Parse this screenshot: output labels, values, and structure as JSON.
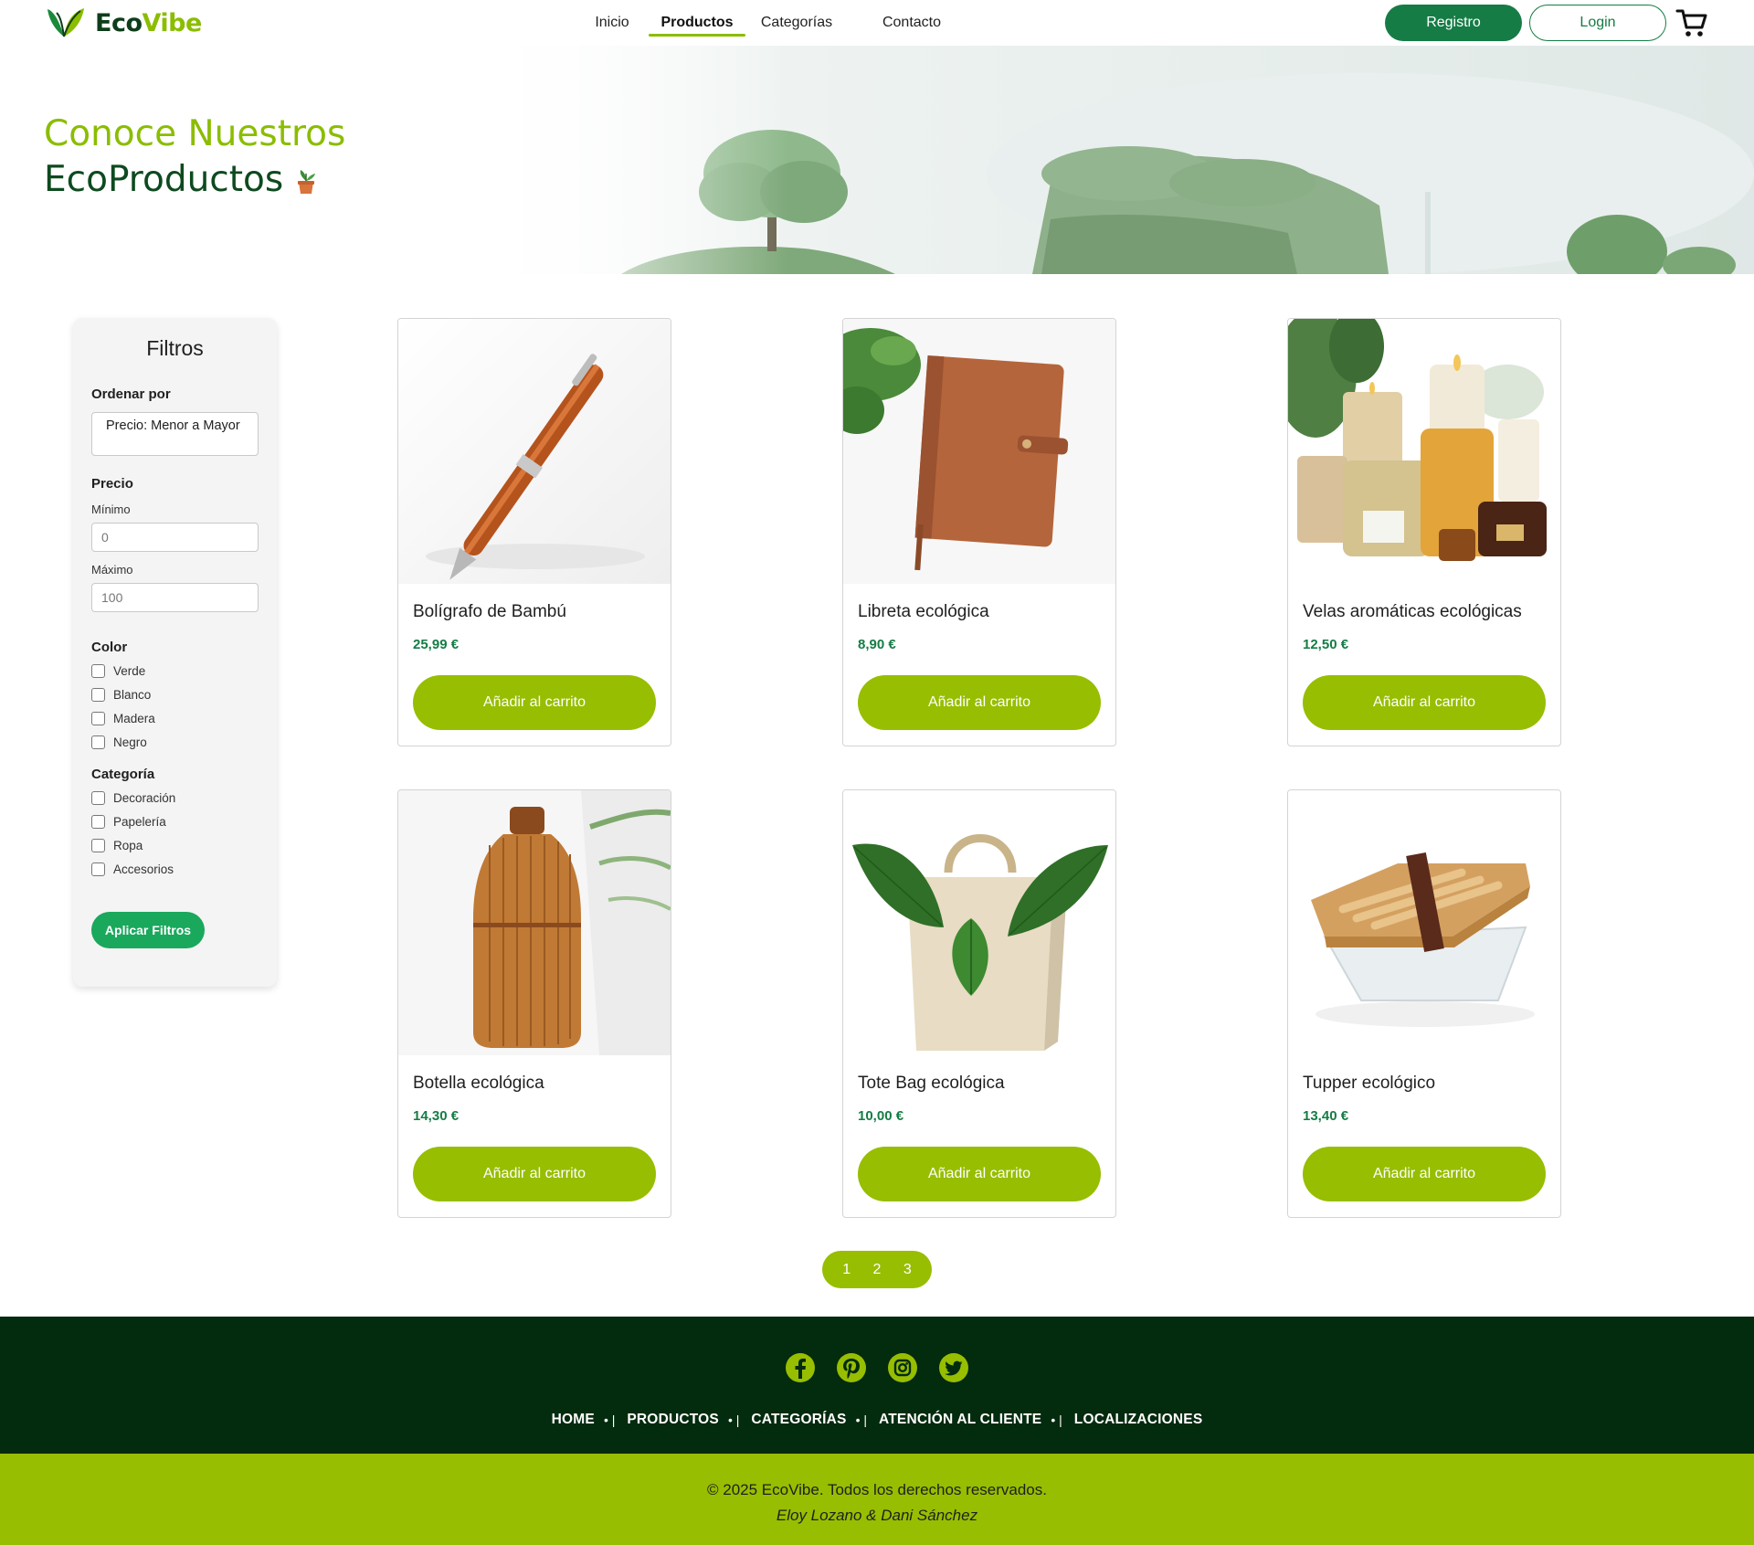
{
  "brand": {
    "eco": "Eco",
    "vibe": "Vibe"
  },
  "nav": {
    "items": [
      {
        "label": "Inicio",
        "active": false
      },
      {
        "label": "Productos",
        "active": true
      },
      {
        "label": "Categorías",
        "active": false
      },
      {
        "label": "Contacto",
        "active": false
      }
    ],
    "registro_label": "Registro",
    "login_label": "Login"
  },
  "hero": {
    "line1": "Conoce Nuestros",
    "line2": "EcoProductos"
  },
  "filters": {
    "title": "Filtros",
    "sort_label": "Ordenar por",
    "sort_value": "Precio: Menor a Mayor",
    "price_label": "Precio",
    "min_label": "Mínimo",
    "min_placeholder": "0",
    "max_label": "Máximo",
    "max_placeholder": "100",
    "color_label": "Color",
    "colors": [
      "Verde",
      "Blanco",
      "Madera",
      "Negro"
    ],
    "category_label": "Categoría",
    "categories": [
      "Decoración",
      "Papelería",
      "Ropa",
      "Accesorios"
    ],
    "apply_label": "Aplicar Filtros"
  },
  "products": [
    {
      "name": "Bolígrafo de Bambú",
      "price": "25,99 €",
      "button": "Añadir al carrito"
    },
    {
      "name": "Libreta ecológica",
      "price": "8,90 €",
      "button": "Añadir al carrito"
    },
    {
      "name": "Velas aromáticas ecológicas",
      "price": "12,50 €",
      "button": "Añadir al carrito"
    },
    {
      "name": "Botella ecológica",
      "price": "14,30 €",
      "button": "Añadir al carrito"
    },
    {
      "name": "Tote Bag ecológica",
      "price": "10,00 €",
      "button": "Añadir al carrito"
    },
    {
      "name": "Tupper ecológico",
      "price": "13,40 €",
      "button": "Añadir al carrito"
    }
  ],
  "pagination": {
    "pages": [
      "1",
      "2",
      "3"
    ]
  },
  "footer": {
    "socials": [
      "facebook-icon",
      "pinterest-icon",
      "instagram-icon",
      "twitter-icon"
    ],
    "links": [
      "HOME",
      "PRODUCTOS",
      "CATEGORÍAS",
      "ATENCIÓN AL CLIENTE",
      "LOCALIZACIONES"
    ],
    "separator": "• |",
    "copyright": "© 2025 EcoVibe. Todos los derechos reservados.",
    "authors": "Eloy Lozano & Dani Sánchez"
  },
  "colors": {
    "brand_dark": "#0e3d1a",
    "brand_lime": "#8bbd00",
    "button_lime": "#97be00",
    "primary_green": "#157c45",
    "apply_green": "#1aa85c",
    "footer_dark": "#032b0e"
  }
}
